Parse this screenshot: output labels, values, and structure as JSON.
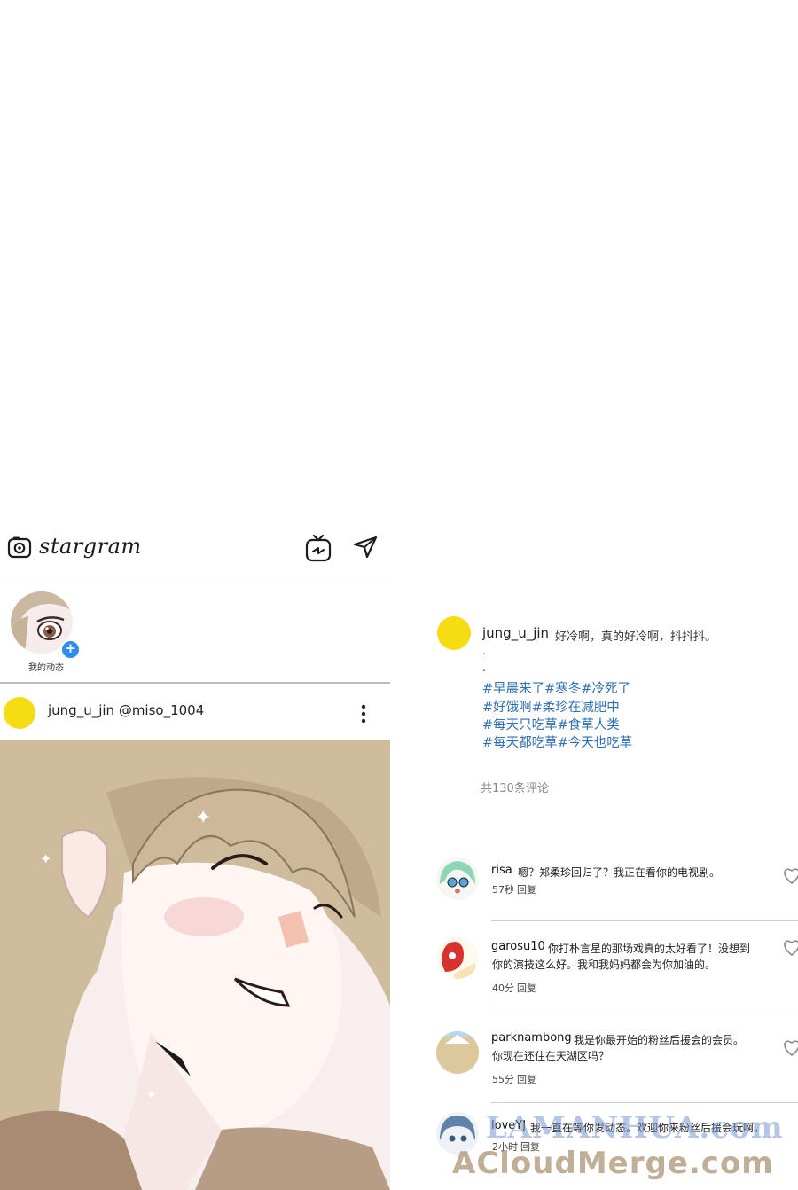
{
  "app": {
    "brand": "stargram",
    "icons": {
      "camera": "camera-icon",
      "tv": "igtv-icon",
      "send": "send-icon"
    }
  },
  "stories": {
    "my_story_label": "我的动态"
  },
  "post": {
    "username_line": "jung_u_jin @miso_1004"
  },
  "caption": {
    "username": "jung_u_jin",
    "text": "好冷啊，真的好冷啊，抖抖抖。",
    "dots": [
      ".",
      "."
    ],
    "hashtags": [
      "#早晨来了#寒冬#冷死了",
      "#好饿啊#柔珍在减肥中",
      "#每天只吃草#食草人类",
      "#每天都吃草#今天也吃草"
    ],
    "total_comments": "共130条评论"
  },
  "comments": [
    {
      "user": "risa",
      "lines": [
        "嗯？郑柔珍回归了？我正在看你的电视剧。"
      ],
      "time": "57秒",
      "reply": "回复"
    },
    {
      "user": "garosu10",
      "lines": [
        "你打朴言星的那场戏真的太好看了！没想到",
        "你的演技这么好。我和我妈妈都会为你加油的。"
      ],
      "time": "40分",
      "reply": "回复"
    },
    {
      "user": "parknambong",
      "lines": [
        "我是你最开始的粉丝后援会的会员。",
        "你现在还住在天湖区吗？"
      ],
      "time": "55分",
      "reply": "回复"
    },
    {
      "user": "loveYJ",
      "lines": [
        "我一直在等你发动态。欢迎你来粉丝后援会玩啊。"
      ],
      "time": "2小时",
      "reply": "回复"
    }
  ],
  "watermark": {
    "line1": "LAMANHUA.com",
    "line2": "ACloudMerge.com"
  },
  "colors": {
    "avatar_yellow": "#f5dc13",
    "hashtag_blue": "#2f6fb5",
    "plus_blue": "#2f8df0"
  }
}
